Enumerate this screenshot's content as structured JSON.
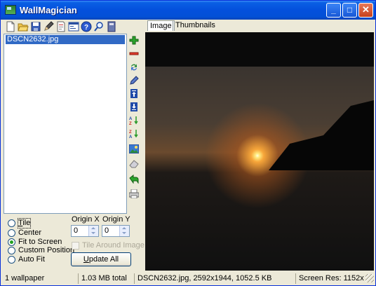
{
  "window": {
    "title": "WallMagician",
    "caption_buttons": {
      "minimize": "_",
      "maximize": "□",
      "close": "✕"
    }
  },
  "toolbar": {
    "icons": [
      "new-file-icon",
      "open-folder-icon",
      "save-icon",
      "edit-pencil-icon",
      "document-icon",
      "properties-icon",
      "help-icon",
      "search-tool-icon",
      "book-icon"
    ]
  },
  "file_list": {
    "items": [
      "DSCN2632.jpg"
    ]
  },
  "side_toolbar": {
    "icons": [
      "add-icon",
      "remove-icon",
      "refresh-icon",
      "edit-icon",
      "move-top-icon",
      "move-bottom-icon",
      "sort-asc-icon",
      "sort-desc-icon",
      "image-icon",
      "eraser-icon",
      "back-arrow-icon",
      "printer-icon"
    ]
  },
  "position_options": {
    "items": [
      {
        "label": "Tile",
        "checked": false
      },
      {
        "label": "Center",
        "checked": false
      },
      {
        "label": "Fit to Screen",
        "checked": true
      },
      {
        "label": "Custom Position",
        "checked": false
      },
      {
        "label": "Auto Fit",
        "checked": false
      }
    ]
  },
  "origin": {
    "x_label": "Origin X",
    "y_label": "Origin Y",
    "x_value": "0",
    "y_value": "0"
  },
  "tile_around_image": {
    "label": "Tile Around Image",
    "checked": false,
    "enabled": false
  },
  "update_button": {
    "label": "Update All"
  },
  "tabs": [
    {
      "label": "Image",
      "active": true
    },
    {
      "label": "Thumbnails",
      "active": false
    }
  ],
  "status_bar": {
    "count": "1 wallpaper",
    "total": "1.03 MB total",
    "file_info": "DSCN2632.jpg, 2592x1944, 1052.5 KB",
    "screen_res": "Screen Res: 1152x864,"
  },
  "colors": {
    "titlebar": "#0450dc",
    "selection": "#316ac5",
    "window_bg": "#ece9d8",
    "preview_bg": "#0a0a0a"
  }
}
